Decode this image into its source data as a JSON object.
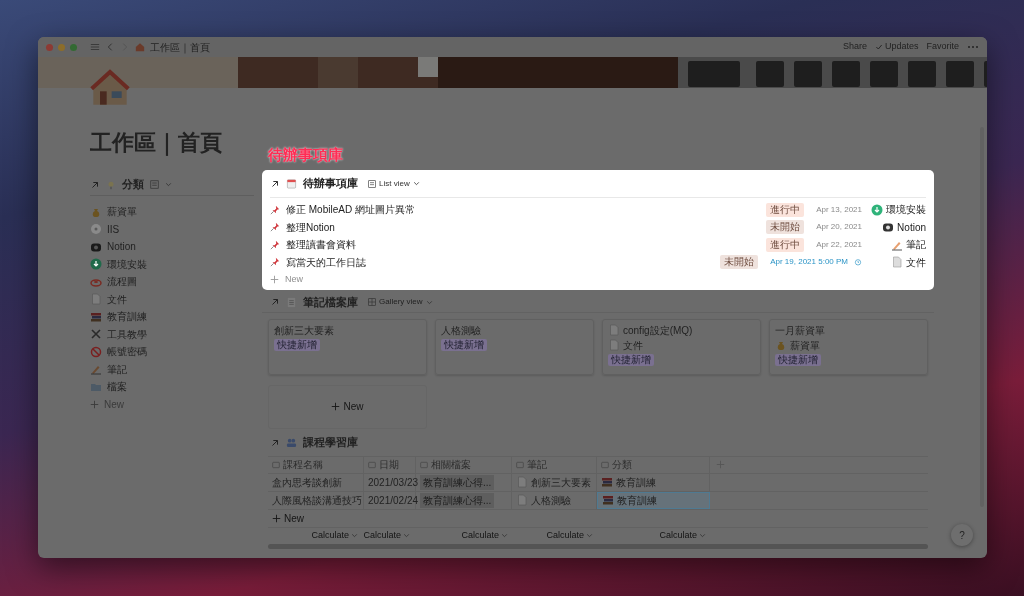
{
  "titlebar": {
    "breadcrumb": "工作區｜首頁",
    "actions": [
      {
        "label": "Share"
      },
      {
        "label": "Updates"
      },
      {
        "label": "Favorite"
      }
    ]
  },
  "page": {
    "title": "工作區｜首頁"
  },
  "categories": {
    "title": "分類",
    "items": [
      {
        "label": "薪資單"
      },
      {
        "label": "IIS"
      },
      {
        "label": "Notion"
      },
      {
        "label": "環境安裝"
      },
      {
        "label": "流程圖"
      },
      {
        "label": "文件"
      },
      {
        "label": "教育訓練"
      },
      {
        "label": "工具教學"
      },
      {
        "label": "帳號密碼"
      },
      {
        "label": "筆記"
      },
      {
        "label": "檔案"
      }
    ],
    "new_label": "New"
  },
  "highlight_label": "待辦事項庫",
  "todo": {
    "title": "待辦事項庫",
    "view": "List view",
    "rows": [
      {
        "title": "修正 MobileAD 網址圖片異常",
        "status": "進行中",
        "color": "#fbe4dc",
        "date": "Apr 13, 2021",
        "reminder": false,
        "category": "環境安裝"
      },
      {
        "title": "整理Notion",
        "status": "未開始",
        "color": "#efe2dd",
        "date": "Apr 20, 2021",
        "reminder": false,
        "category": "Notion"
      },
      {
        "title": "整理讀書會資料",
        "status": "進行中",
        "color": "#fbe4dc",
        "date": "Apr 22, 2021",
        "reminder": false,
        "category": "筆記"
      },
      {
        "title": "寫當天的工作日誌",
        "status": "未開始",
        "color": "#efe2dd",
        "date": "Apr 19, 2021 5:00 PM",
        "reminder": true,
        "category": "文件"
      }
    ],
    "new_label": "New"
  },
  "gallery": {
    "title": "筆記檔案庫",
    "view": "Gallery view",
    "cards": [
      {
        "title": "創新三大要素",
        "page_icon": false,
        "tag": "快捷新增"
      },
      {
        "title": "人格測驗",
        "page_icon": false,
        "tag": "快捷新增"
      },
      {
        "title": "config設定(MQ)",
        "page_icon": true,
        "property": "文件",
        "tag": "快捷新增"
      },
      {
        "title": "一月薪資單",
        "page_icon": false,
        "property": "薪資單",
        "tag": "快捷新增"
      }
    ],
    "new_label": "New"
  },
  "courses": {
    "title": "課程學習庫",
    "columns": [
      {
        "label": "課程名稱"
      },
      {
        "label": "日期"
      },
      {
        "label": "相關檔案"
      },
      {
        "label": "筆記"
      },
      {
        "label": "分類"
      }
    ],
    "rows": [
      {
        "name": "盒內思考談創新",
        "date": "2021/03/23",
        "related": "教育訓練心得...",
        "note": "創新三大要素",
        "category": "教育訓練",
        "category_selected": false
      },
      {
        "name": "人際風格談溝通技巧",
        "date": "2021/02/24",
        "related": "教育訓練心得...",
        "note": "人格測驗",
        "category": "教育訓練",
        "category_selected": true
      }
    ],
    "new_label": "New",
    "calculate": [
      "Calculate",
      "Calculate",
      "Calculate",
      "Calculate",
      "Calculate"
    ]
  },
  "help": "?"
}
